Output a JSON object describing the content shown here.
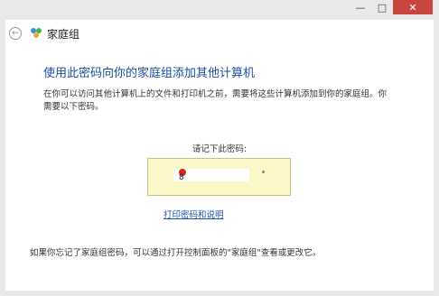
{
  "window": {
    "minimize_glyph": "—",
    "maximize_glyph": "□",
    "close_glyph": "✕"
  },
  "nav": {
    "title": "家庭组",
    "back_glyph": "←"
  },
  "content": {
    "heading": "使用此密码向你的家庭组添加其他计算机",
    "description": "在你可以访问其他计算机上的文件和打印机之前，需要将这些计算机添加到你的家庭组。你需要以下密码。",
    "code_label": "请记下此密码:",
    "print_link": "打印密码和说明",
    "footer": "如果你忘记了家庭组密码，可以通过打开控制面板的\"家庭组\"查看或更改它。"
  },
  "colors": {
    "heading": "#1a4fa0",
    "link": "#1a56b0",
    "code_box_bg": "#fbf7c9",
    "close_button": "#c7463f"
  },
  "icons": [
    "back-arrow-icon",
    "homegroup-icon",
    "minimize-icon",
    "maximize-icon",
    "close-icon"
  ]
}
